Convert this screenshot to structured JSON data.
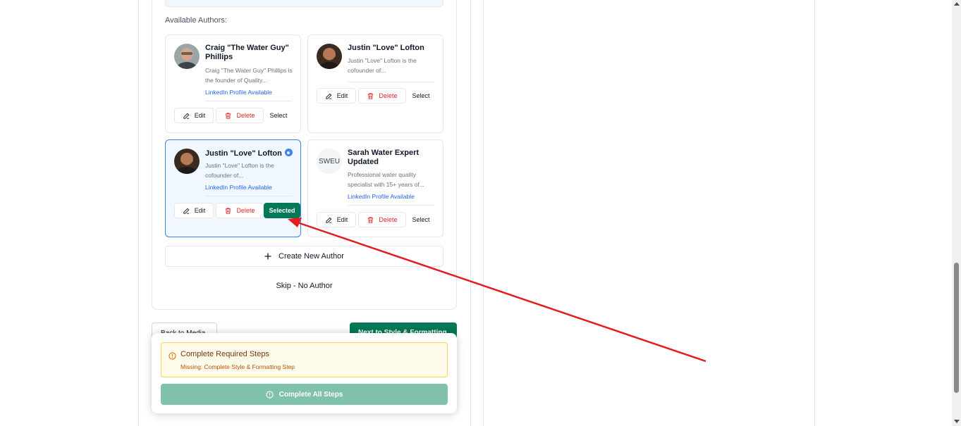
{
  "authors_section": {
    "label": "Available Authors:",
    "authors": [
      {
        "name": "Craig \"The Water Guy\" Phillips",
        "description": "Craig \"The Water Guy\" Phillips is the founder of Quality...",
        "linkedin": "LinkedIn Profile Available",
        "edit_label": "Edit",
        "delete_label": "Delete",
        "select_label": "Select"
      },
      {
        "name": "Justin \"Love\" Lofton",
        "description": "Justin \"Love\" Lofton is the cofounder of...",
        "edit_label": "Edit",
        "delete_label": "Delete",
        "select_label": "Select"
      },
      {
        "name": "Justin \"Love\" Lofton",
        "description": "Justin \"Love\" Lofton is the cofounder of...",
        "linkedin": "LinkedIn Profile Available",
        "edit_label": "Edit",
        "delete_label": "Delete",
        "select_label": "Selected",
        "selected": true
      },
      {
        "initials": "SWEU",
        "name": "Sarah Water Expert Updated",
        "description": "Professional water quality specialist with 15+ years of...",
        "linkedin": "LinkedIn Profile Available",
        "edit_label": "Edit",
        "delete_label": "Delete",
        "select_label": "Select"
      }
    ],
    "create_label": "Create New Author",
    "skip_label": "Skip - No Author"
  },
  "nav": {
    "back_label": "Back to Media",
    "next_label": "Next to Style & Formatting"
  },
  "status": {
    "title": "Complete Required Steps",
    "message": "Missing: Complete Style & Formatting Step",
    "complete_label": "Complete All Steps"
  },
  "colors": {
    "primary_green": "#047857",
    "disabled_green": "#7fc1a9",
    "selected_blue": "#3b82f6",
    "delete_red": "#dc2626",
    "link_blue": "#2563eb",
    "warning_bg": "#fffbeb",
    "warning_border": "#fcd34d",
    "annotation_arrow": "#e11d1d"
  },
  "icons": {
    "edit": "pencil-icon",
    "delete": "trash-icon",
    "create": "plus-icon",
    "warning": "alert-circle-icon",
    "selected": "radio-selected-icon"
  }
}
